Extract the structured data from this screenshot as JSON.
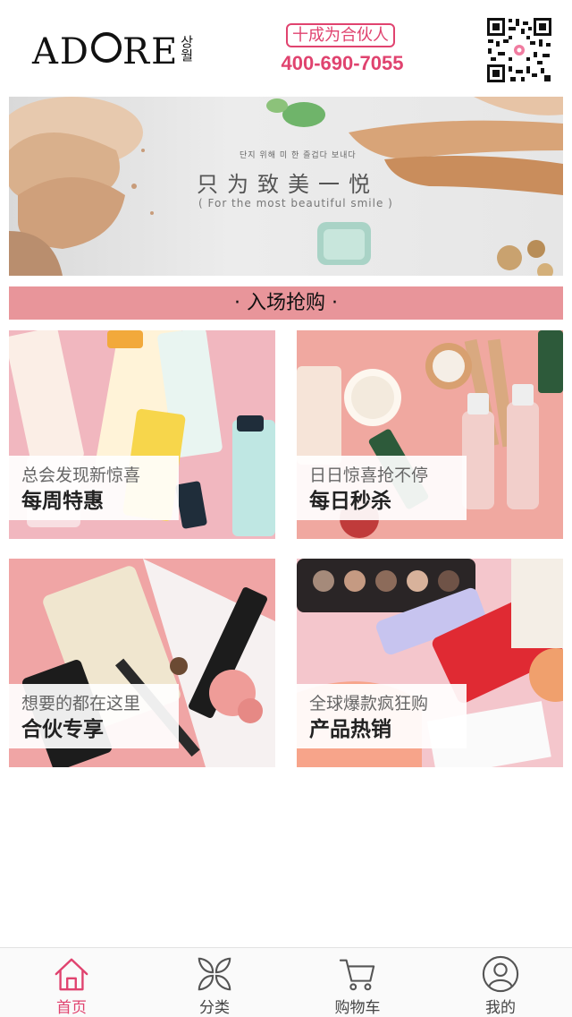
{
  "header": {
    "logo_text_1": "AD",
    "logo_text_2": "RE",
    "logo_korean": "상월",
    "partner_label": "十成为合伙人",
    "phone": "400-690-7055"
  },
  "banner": {
    "korean_line": "단지 위해 미 한 즐겁다 보내다",
    "slogan": "只为致美一悦",
    "subtitle": "( For the most beautiful smile )"
  },
  "section_title": "· 入场抢购 ·",
  "cards": [
    {
      "sub": "总会发现新惊喜",
      "main": "每周特惠"
    },
    {
      "sub": "日日惊喜抢不停",
      "main": "每日秒杀"
    },
    {
      "sub": "想要的都在这里",
      "main": "合伙专享"
    },
    {
      "sub": "全球爆款疯狂购",
      "main": "产品热销"
    }
  ],
  "tabbar": {
    "items": [
      {
        "label": "首页",
        "icon": "home-icon"
      },
      {
        "label": "分类",
        "icon": "category-icon"
      },
      {
        "label": "购物车",
        "icon": "cart-icon"
      },
      {
        "label": "我的",
        "icon": "user-icon"
      }
    ],
    "active_index": 0
  },
  "colors": {
    "accent": "#e0436f",
    "section_bar": "#e8959a"
  }
}
